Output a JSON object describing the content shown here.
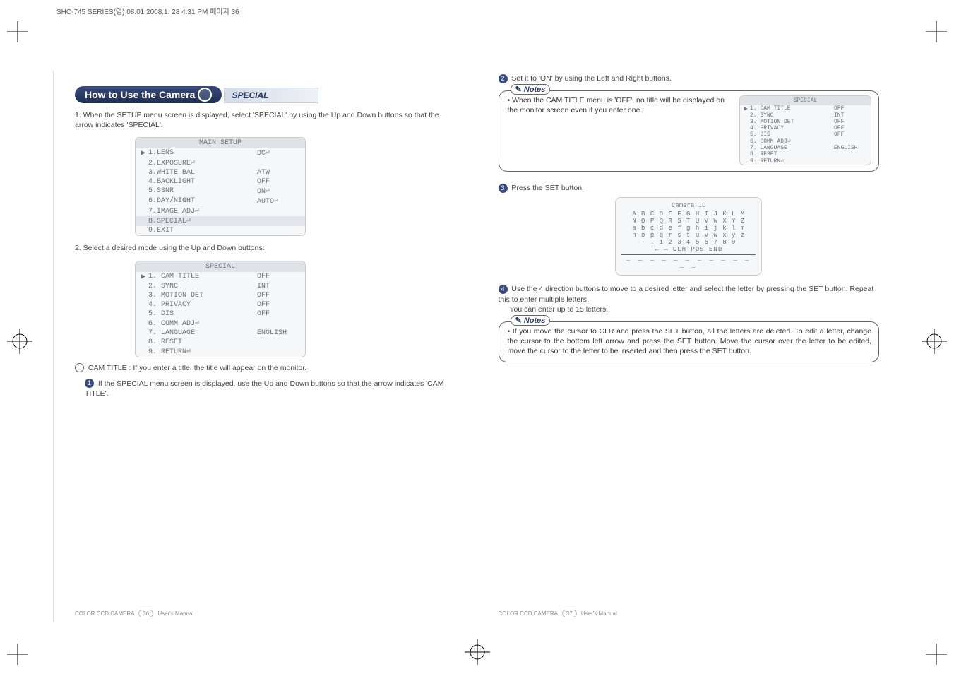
{
  "header_bar": "SHC-745 SERIES(영) 08.01  2008.1. 28 4:31 PM  페이지 36",
  "title_tab": "How to Use the Camera",
  "section_label": "SPECIAL",
  "left": {
    "step1": "1. When the SETUP menu screen is displayed, select 'SPECIAL' by using the Up and Down buttons so that the arrow indicates 'SPECIAL'.",
    "menu1": {
      "header": "MAIN SETUP",
      "items": [
        {
          "label": "1.LENS",
          "val": "DC⏎",
          "sel": true
        },
        {
          "label": "2.EXPOSURE⏎",
          "val": ""
        },
        {
          "label": "3.WHITE BAL",
          "val": "ATW"
        },
        {
          "label": "4.BACKLIGHT",
          "val": "OFF"
        },
        {
          "label": "5.SSNR",
          "val": "ON⏎"
        },
        {
          "label": "6.DAY/NIGHT",
          "val": "AUTO⏎"
        },
        {
          "label": "7.IMAGE ADJ⏎",
          "val": ""
        },
        {
          "label": "8.SPECIAL⏎",
          "val": "",
          "sel_special": true
        },
        {
          "label": "9.EXIT",
          "val": ""
        }
      ]
    },
    "step2": "2. Select a desired mode using the Up and Down buttons.",
    "menu2": {
      "header": "SPECIAL",
      "items": [
        {
          "label": "1. CAM TITLE",
          "val": "OFF",
          "sel": true
        },
        {
          "label": "2. SYNC",
          "val": "INT"
        },
        {
          "label": "3. MOTION DET",
          "val": "OFF"
        },
        {
          "label": "4. PRIVACY",
          "val": "OFF"
        },
        {
          "label": "5. DIS",
          "val": "OFF"
        },
        {
          "label": "6. COMM ADJ⏎",
          "val": ""
        },
        {
          "label": "7. LANGUAGE",
          "val": "ENGLISH"
        },
        {
          "label": "8. RESET",
          "val": ""
        },
        {
          "label": "9. RETURN⏎",
          "val": ""
        }
      ]
    },
    "cam_title_intro": "CAM TITLE : If you enter a title, the title will appear on the monitor.",
    "bullet1": "If the SPECIAL menu screen is displayed, use the Up and Down buttons so that the arrow indicates 'CAM TITLE'.",
    "footer_left": "COLOR CCD CAMERA",
    "footer_pg": "36",
    "footer_right": "User's Manual"
  },
  "right": {
    "bullet2": "Set it to 'ON' by using the Left and Right buttons.",
    "notes_label": "Notes",
    "note1_text": "• When the CAM TITLE menu is 'OFF', no title will be displayed on the monitor screen even if you enter one.",
    "mini_menu": {
      "header": "SPECIAL",
      "items": [
        {
          "label": "1. CAM TITLE",
          "val": "OFF",
          "sel": true
        },
        {
          "label": "2. SYNC",
          "val": "INT"
        },
        {
          "label": "3. MOTION DET",
          "val": "OFF"
        },
        {
          "label": "4. PRIVACY",
          "val": "OFF"
        },
        {
          "label": "5. DIS",
          "val": "OFF"
        },
        {
          "label": "6. COMM ADJ⏎",
          "val": ""
        },
        {
          "label": "7. LANGUAGE",
          "val": "ENGLISH"
        },
        {
          "label": "8. RESET",
          "val": ""
        },
        {
          "label": "9. RETURN⏎",
          "val": ""
        }
      ]
    },
    "bullet3": "Press the SET button.",
    "camera_id": {
      "title": "Camera ID",
      "rows": [
        "A B C D E F G H I J K L M",
        "N O P Q R S T U V W X Y Z",
        "a b c d e f g h i j k l m",
        "n o p q r s t u v w x y z",
        "- . 1 2 3 4 5 6 7 8 9",
        "← →  CLR  POS  END"
      ]
    },
    "bullet4": "Use the 4 direction buttons to move to a desired letter and select the letter by pressing the SET button. Repeat this to enter multiple letters.",
    "bullet4b": "You can enter up to 15 letters.",
    "note2_text": "• If you move the cursor to CLR and press the SET button, all the letters are deleted. To edit a letter, change the cursor to the bottom left arrow and press the SET button. Move the cursor over the letter to be edited, move the cursor to the letter to be inserted and then press the SET button.",
    "footer_left": "COLOR CCD CAMERA",
    "footer_pg": "37",
    "footer_right": "User's Manual"
  }
}
